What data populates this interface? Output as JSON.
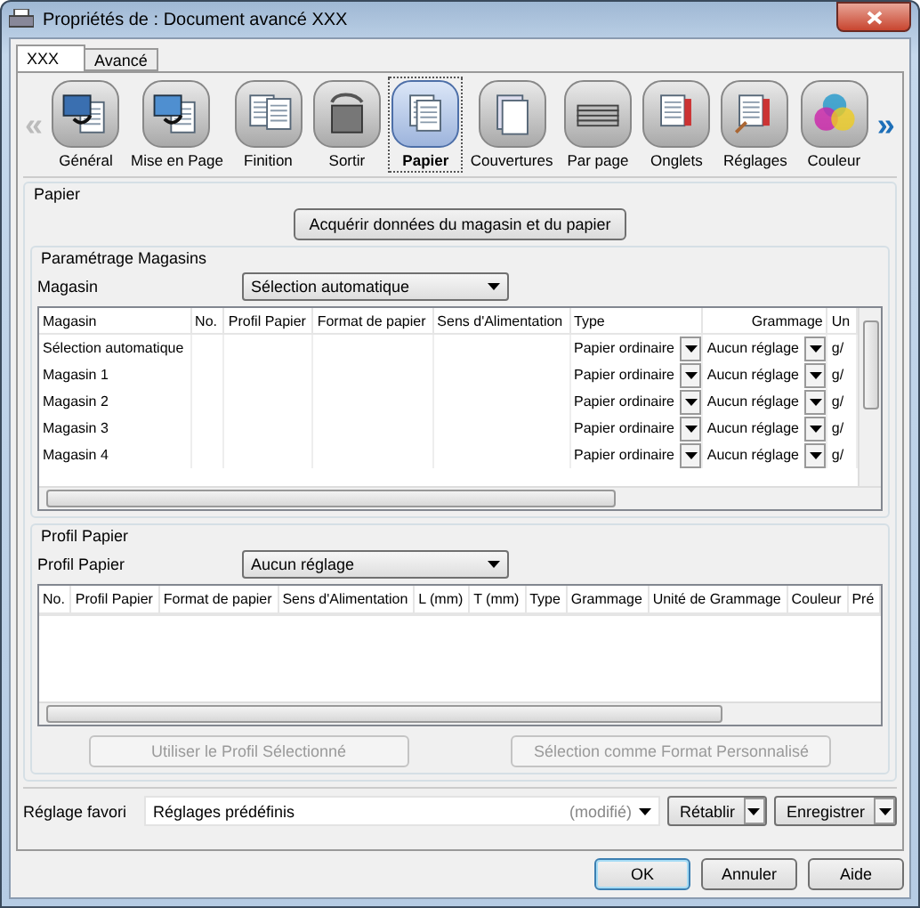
{
  "window": {
    "title": "Propriétés de : Document avancé XXX"
  },
  "tabs": [
    {
      "label": "XXX",
      "selected": true
    },
    {
      "label": "Avancé",
      "selected": false
    }
  ],
  "toolbar": {
    "prev": "«",
    "next": "»",
    "items": [
      {
        "label": "Général",
        "kind": "general",
        "selected": false
      },
      {
        "label": "Mise en Page",
        "kind": "layout",
        "selected": false
      },
      {
        "label": "Finition",
        "kind": "finishing",
        "selected": false
      },
      {
        "label": "Sortir",
        "kind": "output",
        "selected": false
      },
      {
        "label": "Papier",
        "kind": "paper",
        "selected": true
      },
      {
        "label": "Couvertures",
        "kind": "cover",
        "selected": false
      },
      {
        "label": "Par page",
        "kind": "perpage",
        "selected": false
      },
      {
        "label": "Onglets",
        "kind": "tabs",
        "selected": false
      },
      {
        "label": "Réglages",
        "kind": "settings",
        "selected": false
      },
      {
        "label": "Couleur",
        "kind": "color",
        "selected": false
      }
    ]
  },
  "paper_group": {
    "title": "Papier",
    "acquire_button": "Acquérir données du magasin et du papier",
    "trays": {
      "title": "Paramétrage Magasins",
      "label": "Magasin",
      "value": "Sélection automatique",
      "columns": [
        "Magasin",
        "No.",
        "Profil Papier",
        "Format de papier",
        "Sens d'Alimentation",
        "Type",
        "Grammage",
        "Un"
      ],
      "rows": [
        {
          "magasin": "Sélection automatique",
          "type": "Papier ordinaire",
          "grammage": "Aucun réglage",
          "unit": "g/"
        },
        {
          "magasin": "Magasin 1",
          "type": "Papier ordinaire",
          "grammage": "Aucun réglage",
          "unit": "g/"
        },
        {
          "magasin": "Magasin 2",
          "type": "Papier ordinaire",
          "grammage": "Aucun réglage",
          "unit": "g/"
        },
        {
          "magasin": "Magasin 3",
          "type": "Papier ordinaire",
          "grammage": "Aucun réglage",
          "unit": "g/"
        },
        {
          "magasin": "Magasin 4",
          "type": "Papier ordinaire",
          "grammage": "Aucun réglage",
          "unit": "g/"
        }
      ]
    },
    "profile": {
      "title": "Profil Papier",
      "label": "Profil Papier",
      "value": "Aucun réglage",
      "columns": [
        "No.",
        "Profil Papier",
        "Format de papier",
        "Sens d'Alimentation",
        "L (mm)",
        "T (mm)",
        "Type",
        "Grammage",
        "Unité de Grammage",
        "Couleur",
        "Pré"
      ],
      "buttons": [
        {
          "label": "Utiliser le Profil Sélectionné",
          "disabled": true
        },
        {
          "label": "Sélection comme Format Personnalisé",
          "disabled": true
        }
      ]
    }
  },
  "favorite": {
    "label": "Réglage favori",
    "value": "Réglages prédéfinis",
    "note": "(modifié)",
    "buttons": [
      "Rétablir",
      "Enregistrer"
    ]
  },
  "buttons": [
    {
      "label": "OK",
      "default": true
    },
    {
      "label": "Annuler",
      "default": false
    },
    {
      "label": "Aide",
      "default": false
    }
  ]
}
